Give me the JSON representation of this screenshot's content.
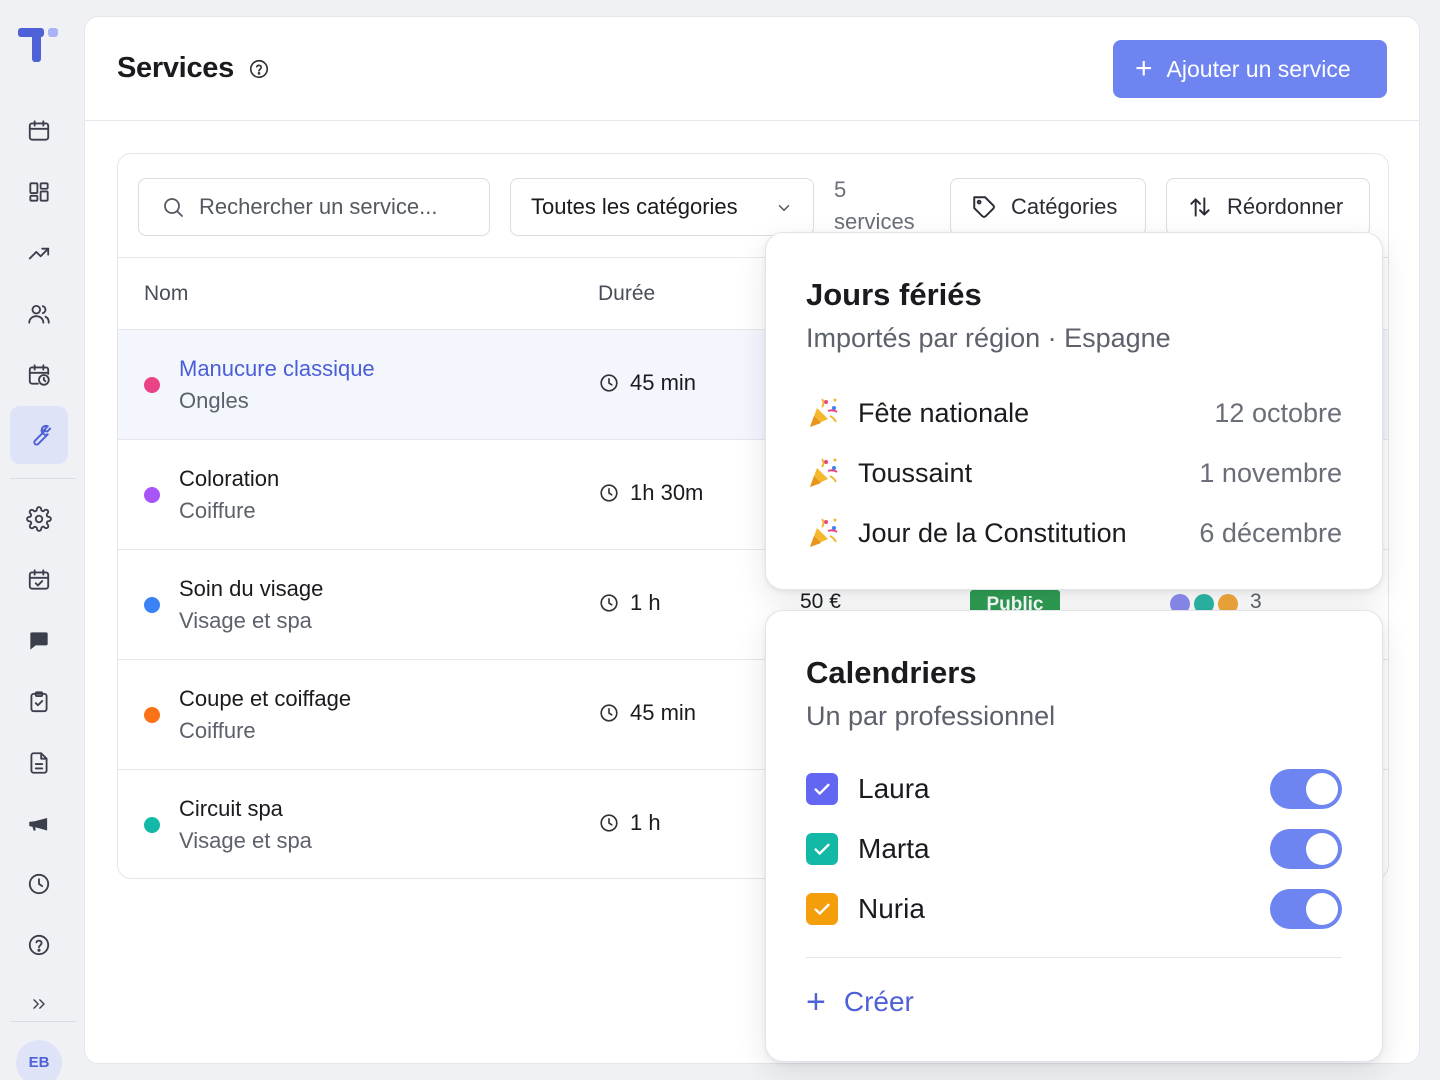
{
  "header": {
    "title": "Services",
    "add_button": "Ajouter un service"
  },
  "sidebar": {
    "avatar_initials": "EB",
    "active_item": "services",
    "items": [
      "calendar",
      "dashboard",
      "analytics",
      "clients",
      "schedule",
      "services",
      "settings",
      "tasks",
      "messages",
      "checklist",
      "documents",
      "marketing",
      "history",
      "help",
      "expand"
    ]
  },
  "toolbar": {
    "search_placeholder": "Rechercher un service...",
    "category_filter": "Toutes les catégories",
    "count_number": "5",
    "count_label": "services",
    "categories_button": "Catégories",
    "reorder_button": "Réordonner"
  },
  "table": {
    "columns": [
      "Nom",
      "Durée"
    ],
    "rows": [
      {
        "name": "Manucure classique",
        "category": "Ongles",
        "duration": "45 min",
        "color": "#e94386",
        "selected": true
      },
      {
        "name": "Coloration",
        "category": "Coiffure",
        "duration": "1h 30m",
        "color": "#a855f7",
        "selected": false
      },
      {
        "name": "Soin du visage",
        "category": "Visage et spa",
        "duration": "1 h",
        "color": "#3b82f6",
        "selected": false
      },
      {
        "name": "Coupe et coiffage",
        "category": "Coiffure",
        "duration": "45 min",
        "color": "#f97316",
        "selected": false
      },
      {
        "name": "Circuit spa",
        "category": "Visage et spa",
        "duration": "1 h",
        "color": "#14b8a6",
        "selected": false
      }
    ],
    "partial_row": {
      "price": "50 €",
      "visibility": "Public",
      "staff_count": "3",
      "staff_colors": [
        "#8b8cf0",
        "#2bb8a5",
        "#f2a93b"
      ]
    }
  },
  "holidays_popover": {
    "title": "Jours fériés",
    "subtitle": "Importés par région · Espagne",
    "items": [
      {
        "name": "Fête nationale",
        "date": "12 octobre"
      },
      {
        "name": "Toussaint",
        "date": "1 novembre"
      },
      {
        "name": "Jour de la Constitution",
        "date": "6 décembre"
      }
    ]
  },
  "calendars_popover": {
    "title": "Calendriers",
    "subtitle": "Un par professionnel",
    "items": [
      {
        "name": "Laura",
        "color": "#6366f1",
        "checked": true,
        "enabled": true
      },
      {
        "name": "Marta",
        "color": "#14b8a6",
        "checked": true,
        "enabled": true
      },
      {
        "name": "Nuria",
        "color": "#f59e0b",
        "checked": true,
        "enabled": true
      }
    ],
    "create_label": "Créer"
  },
  "colors": {
    "accent": "#6e84f0",
    "accent_text": "#4f61d6",
    "public_badge": "#2f9e53"
  }
}
